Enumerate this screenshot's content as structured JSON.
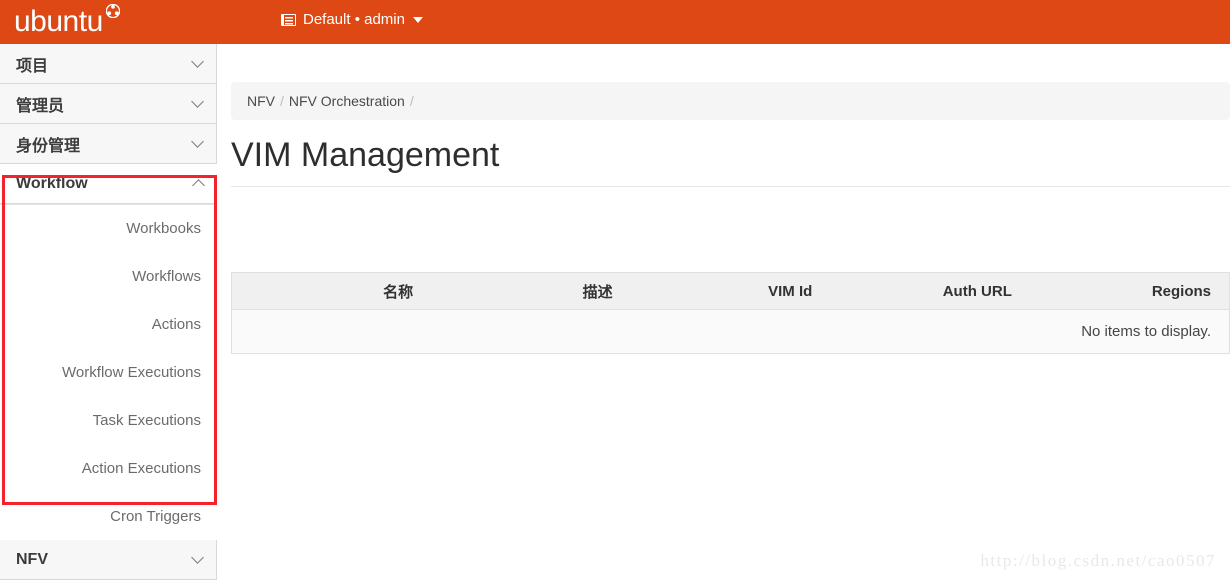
{
  "topbar": {
    "brand": "ubuntu",
    "brand_mark_icon": "ubuntu-circle-of-friends-icon",
    "context_icon": "list-icon",
    "context_label": "Default • admin",
    "caret_icon": "caret-down-icon",
    "background_color": "#dd4814"
  },
  "sidebar": {
    "sections": [
      {
        "label": "项目",
        "expanded": false,
        "chevron_icon": "chevron-down-icon"
      },
      {
        "label": "管理员",
        "expanded": false,
        "chevron_icon": "chevron-down-icon"
      },
      {
        "label": "身份管理",
        "expanded": false,
        "chevron_icon": "chevron-down-icon"
      },
      {
        "label": "Workflow",
        "expanded": true,
        "chevron_icon": "chevron-up-icon"
      },
      {
        "label": "NFV",
        "expanded": false,
        "chevron_icon": "chevron-down-icon"
      }
    ],
    "workflow_items": [
      "Workbooks",
      "Workflows",
      "Actions",
      "Workflow Executions",
      "Task Executions",
      "Action Executions",
      "Cron Triggers"
    ],
    "annotation_color": "#f5222d"
  },
  "main": {
    "breadcrumb": [
      {
        "label": "NFV"
      },
      {
        "label": "NFV Orchestration"
      }
    ],
    "breadcrumb_separator": "/",
    "page_title": "VIM Management",
    "table": {
      "columns": [
        "名称",
        "描述",
        "VIM Id",
        "Auth URL",
        "Regions"
      ],
      "rows": [],
      "empty_message": "No items to display."
    }
  },
  "watermark": "http://blog.csdn.net/cao0507"
}
